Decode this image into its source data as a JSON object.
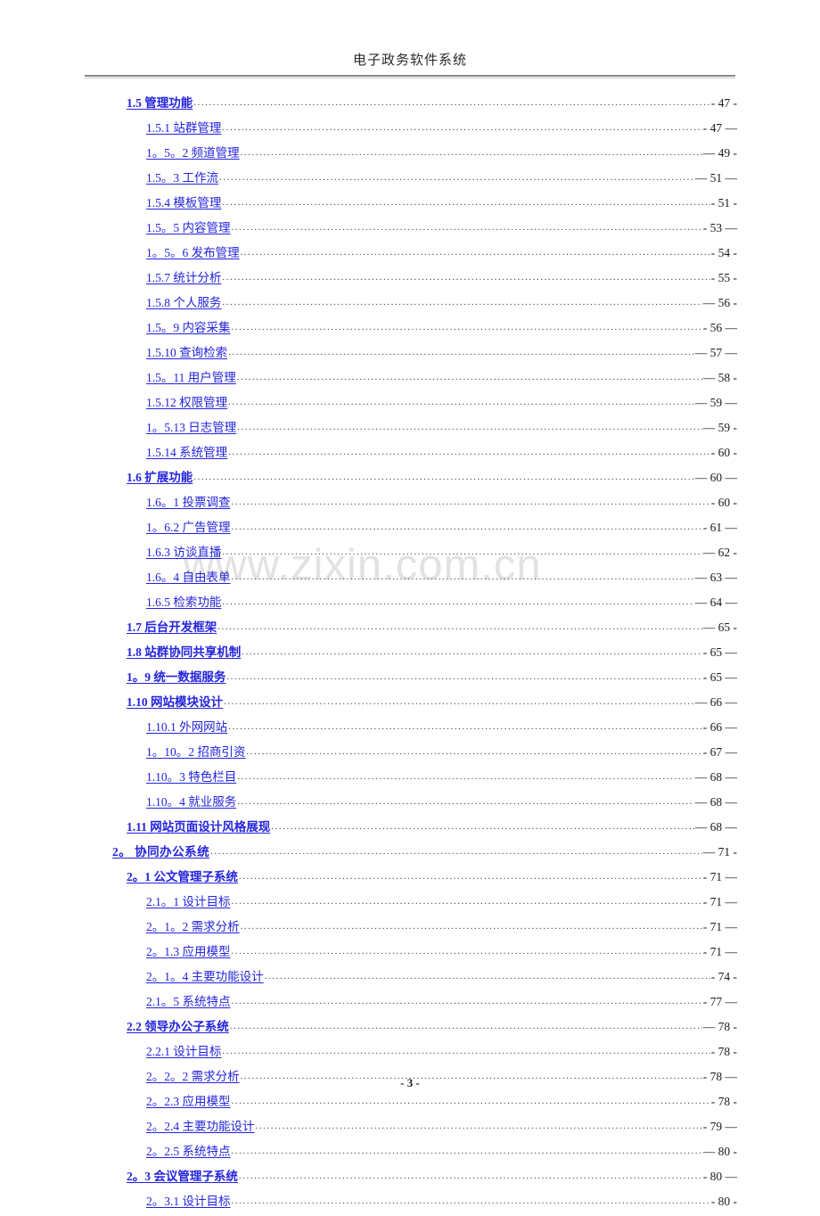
{
  "header": {
    "title": "电子政务软件系统"
  },
  "watermark": {
    "text": "www.zixin.com.cn"
  },
  "footer": {
    "page_number": "- 3 -"
  },
  "toc": {
    "entries": [
      {
        "label": "1.5  管理功能",
        "page": "- 47 -",
        "level": 2
      },
      {
        "label": "1.5.1  站群管理",
        "page": "- 47 —",
        "level": 3
      },
      {
        "label": "1。5。2  频道管理",
        "page": "— 49 -",
        "level": 3
      },
      {
        "label": "1.5。3  工作流",
        "page": "— 51 —",
        "level": 3
      },
      {
        "label": "1.5.4  模板管理",
        "page": "- 51 -",
        "level": 3
      },
      {
        "label": "1.5。5  内容管理",
        "page": "- 53 —",
        "level": 3
      },
      {
        "label": "1。5。6  发布管理",
        "page": "- 54 -",
        "level": 3
      },
      {
        "label": "1.5.7  统计分析",
        "page": "- 55 -",
        "level": 3
      },
      {
        "label": "1.5.8  个人服务",
        "page": "— 56 -",
        "level": 3
      },
      {
        "label": "1.5。9  内容采集",
        "page": "- 56 —",
        "level": 3
      },
      {
        "label": "1.5.10  查询检索",
        "page": "— 57 —",
        "level": 3
      },
      {
        "label": "1.5。11  用户管理",
        "page": "— 58 -",
        "level": 3
      },
      {
        "label": "1.5.12  权限管理",
        "page": "— 59 —",
        "level": 3
      },
      {
        "label": "1。5.13  日志管理",
        "page": "— 59 -",
        "level": 3
      },
      {
        "label": "1.5.14  系统管理",
        "page": "- 60 -",
        "level": 3
      },
      {
        "label": "1.6  扩展功能",
        "page": "— 60 —",
        "level": 2
      },
      {
        "label": "1.6。1  投票调查",
        "page": "- 60 -",
        "level": 3
      },
      {
        "label": "1。6.2  广告管理",
        "page": "- 61 —",
        "level": 3
      },
      {
        "label": "1.6.3  访谈直播",
        "page": "— 62 -",
        "level": 3
      },
      {
        "label": "1.6。4  自由表单",
        "page": "— 63 —",
        "level": 3
      },
      {
        "label": "1.6.5  检索功能",
        "page": "— 64 —",
        "level": 3
      },
      {
        "label": "1.7  后台开发框架",
        "page": "— 65 -",
        "level": 2
      },
      {
        "label": "1.8  站群协同共享机制",
        "page": "- 65 —",
        "level": 2
      },
      {
        "label": "1。9  统一数据服务",
        "page": "- 65 —",
        "level": 2
      },
      {
        "label": "1.10  网站模块设计",
        "page": "— 66 —",
        "level": 2
      },
      {
        "label": "1.10.1  外网网站",
        "page": "- 66 —",
        "level": 3
      },
      {
        "label": "1。10。2  招商引资",
        "page": "- 67 —",
        "level": 3
      },
      {
        "label": "1.10。3  特色栏目",
        "page": "— 68 —",
        "level": 3
      },
      {
        "label": "1.10。4  就业服务",
        "page": "— 68 —",
        "level": 3
      },
      {
        "label": "1.11  网站页面设计风格展现",
        "page": "— 68 —",
        "level": 2
      },
      {
        "label": "2。   协同办公系统",
        "page": "— 71 -",
        "level": 1
      },
      {
        "label": "2。1  公文管理子系统",
        "page": "- 71 —",
        "level": 2
      },
      {
        "label": "2.1。1  设计目标",
        "page": "- 71 —",
        "level": 3
      },
      {
        "label": "2。1。2  需求分析",
        "page": "- 71 —",
        "level": 3
      },
      {
        "label": "2。1.3  应用模型",
        "page": "- 71 —",
        "level": 3
      },
      {
        "label": "2。1。4  主要功能设计",
        "page": "- 74 -",
        "level": 3
      },
      {
        "label": "2.1。5  系统特点",
        "page": "- 77 —",
        "level": 3
      },
      {
        "label": "2.2  领导办公子系统",
        "page": "— 78 -",
        "level": 2
      },
      {
        "label": "2.2.1  设计目标",
        "page": "- 78 -",
        "level": 3
      },
      {
        "label": "2。2。2  需求分析",
        "page": "- 78 —",
        "level": 3
      },
      {
        "label": "2。2.3  应用模型",
        "page": "- 78 -",
        "level": 3
      },
      {
        "label": "2。2.4  主要功能设计",
        "page": "- 79 —",
        "level": 3
      },
      {
        "label": "2。2.5  系统特点",
        "page": "— 80 -",
        "level": 3
      },
      {
        "label": "2。3  会议管理子系统",
        "page": "- 80 —",
        "level": 2
      },
      {
        "label": "2。3.1  设计目标",
        "page": "- 80 -",
        "level": 3
      }
    ]
  }
}
